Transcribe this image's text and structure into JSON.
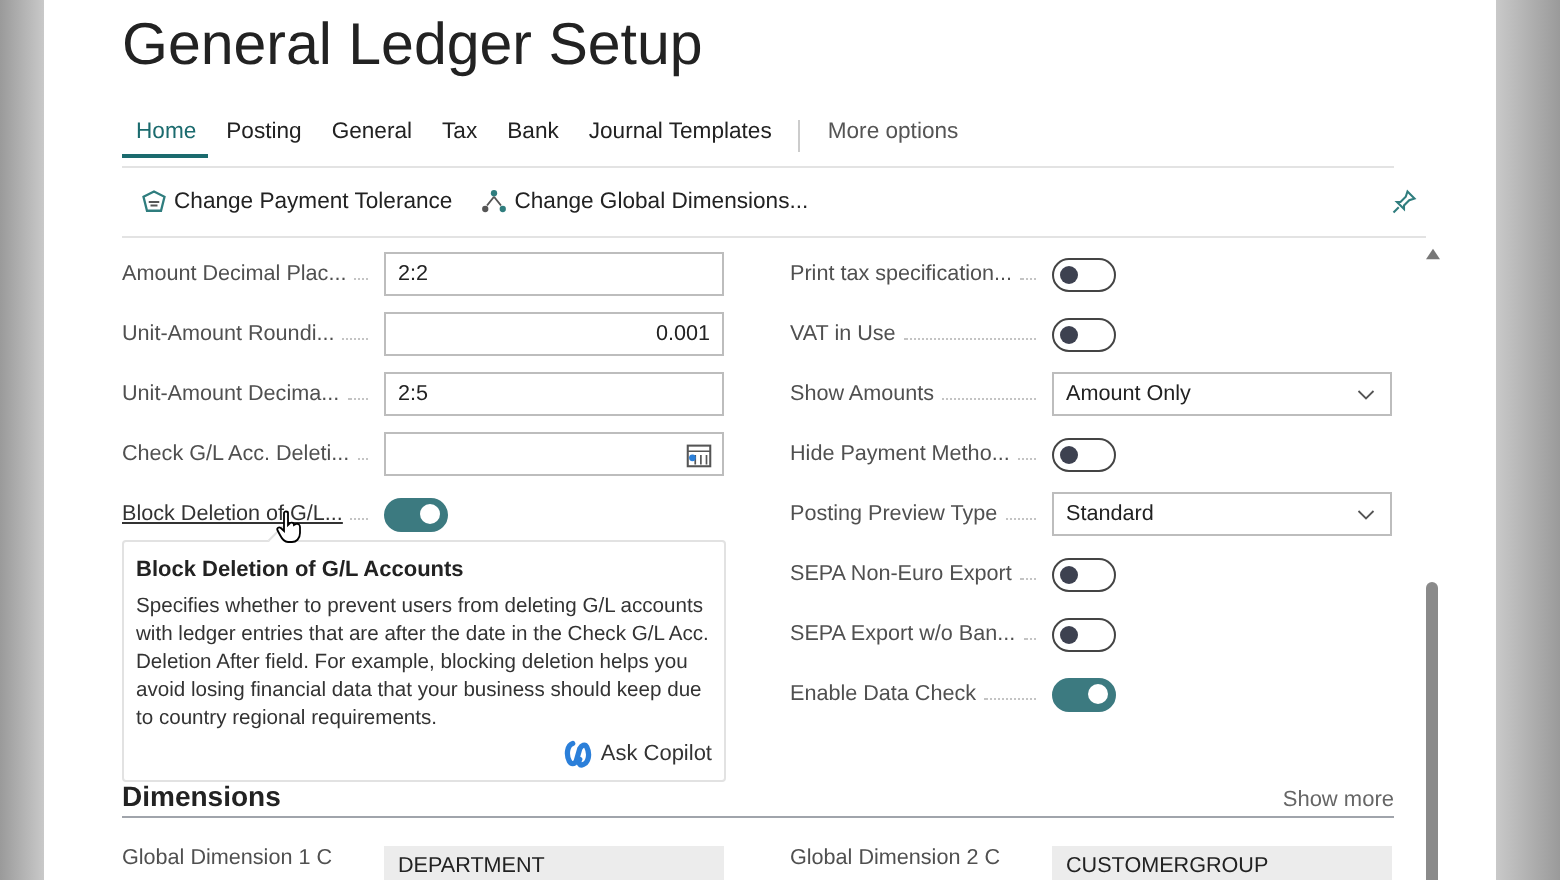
{
  "title": "General Ledger Setup",
  "tabs": [
    {
      "label": "Home",
      "selected": true
    },
    {
      "label": "Posting",
      "selected": false
    },
    {
      "label": "General",
      "selected": false
    },
    {
      "label": "Tax",
      "selected": false
    },
    {
      "label": "Bank",
      "selected": false
    },
    {
      "label": "Journal Templates",
      "selected": false
    }
  ],
  "more_options": "More options",
  "actions": [
    {
      "label": "Change Payment Tolerance",
      "kind": "tolerance"
    },
    {
      "label": "Change Global Dimensions...",
      "kind": "dimensions"
    }
  ],
  "left_fields": [
    {
      "label": "Amount Decimal Plac...",
      "kind": "text",
      "value": "2:2",
      "hovered": false
    },
    {
      "label": "Unit-Amount Roundi...",
      "kind": "number",
      "value": "0.001",
      "hovered": false
    },
    {
      "label": "Unit-Amount Decima...",
      "kind": "text",
      "value": "2:5",
      "hovered": false
    },
    {
      "label": "Check G/L Acc. Deleti...",
      "kind": "date",
      "hovered": false
    },
    {
      "label": "Block Deletion of G/L...",
      "kind": "toggle",
      "on": true,
      "hovered": true
    }
  ],
  "right_fields": [
    {
      "label": "Print tax specification...",
      "kind": "toggle",
      "on": false
    },
    {
      "label": "VAT in Use",
      "kind": "toggle",
      "on": false
    },
    {
      "label": "Show Amounts",
      "kind": "dropdown",
      "value": "Amount Only"
    },
    {
      "label": "Hide Payment Metho...",
      "kind": "toggle",
      "on": false
    },
    {
      "label": "Posting Preview Type",
      "kind": "dropdown",
      "value": "Standard"
    },
    {
      "label": "SEPA Non-Euro Export",
      "kind": "toggle",
      "on": false
    },
    {
      "label": "SEPA Export w/o Ban...",
      "kind": "toggle",
      "on": false
    },
    {
      "label": "Enable Data Check",
      "kind": "toggle",
      "on": true
    }
  ],
  "tooltip": {
    "title": "Block Deletion of G/L Accounts",
    "text": "Specifies whether to prevent users from deleting G/L accounts with ledger entries that are after the date in the Check G/L Acc. Deletion After field. For example, blocking deletion helps you avoid losing financial data that your business should keep due to country regional requirements.",
    "action": "Ask Copilot"
  },
  "section": {
    "title": "Dimensions",
    "action": "Show more",
    "fields": [
      {
        "label": "Global Dimension 1 C",
        "value": "DEPARTMENT"
      },
      {
        "label": "Global Dimension 2 C",
        "value": "CUSTOMERGROUP"
      }
    ]
  }
}
